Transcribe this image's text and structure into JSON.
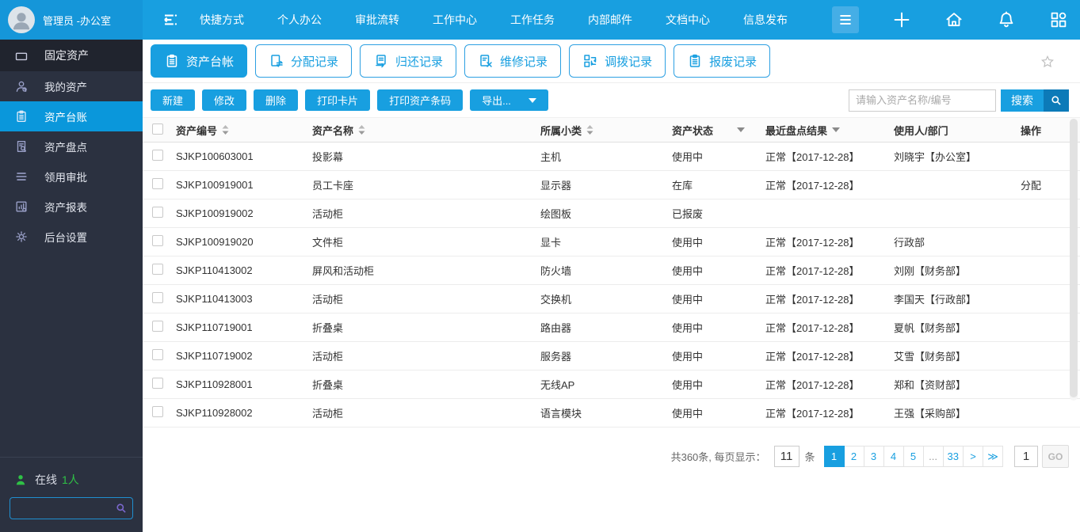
{
  "colors": {
    "accent": "#189fe0",
    "accent_dark": "#0c7ab8",
    "sidebar_bg": "#2b3140",
    "sidebar_active": "#0a97db",
    "online_green": "#2fc146"
  },
  "topbar": {
    "user": "管理员 -办公室",
    "nav": [
      "快捷方式",
      "个人办公",
      "审批流转",
      "工作中心",
      "工作任务",
      "内部邮件",
      "文档中心",
      "信息发布"
    ],
    "right_icons": [
      "plus",
      "home",
      "bell",
      "apps",
      "shirt",
      "power"
    ]
  },
  "sidebar": {
    "section": {
      "label": "固定资产",
      "icon": "briefcase"
    },
    "items": [
      {
        "label": "我的资产",
        "icon": "person",
        "active": false
      },
      {
        "label": "资产台账",
        "icon": "clipboard",
        "active": true
      },
      {
        "label": "资产盘点",
        "icon": "doc-search",
        "active": false
      },
      {
        "label": "领用审批",
        "icon": "layers",
        "active": false
      },
      {
        "label": "资产报表",
        "icon": "report",
        "active": false
      },
      {
        "label": "后台设置",
        "icon": "gear",
        "active": false
      }
    ],
    "online_label": "在线",
    "online_count": "1人"
  },
  "tabs": [
    {
      "label": "资产台帐",
      "icon": "clipboard",
      "active": true
    },
    {
      "label": "分配记录",
      "icon": "doc-swap",
      "active": false
    },
    {
      "label": "归还记录",
      "icon": "doc-return",
      "active": false
    },
    {
      "label": "维修记录",
      "icon": "doc-repair",
      "active": false
    },
    {
      "label": "调拨记录",
      "icon": "transfer",
      "active": false
    },
    {
      "label": "报废记录",
      "icon": "clipboard",
      "active": false
    }
  ],
  "toolbar": {
    "buttons": [
      "新建",
      "修改",
      "删除",
      "打印卡片",
      "打印资产条码"
    ],
    "export_label": "导出...",
    "search_placeholder": "请输入资产名称/编号",
    "search_label": "搜索"
  },
  "table": {
    "headers": [
      {
        "label": "资产编号",
        "sort": true
      },
      {
        "label": "资产名称",
        "sort": true
      },
      {
        "label": "所属小类",
        "sort": true
      },
      {
        "label": "资产状态",
        "filter": true
      },
      {
        "label": "最近盘点结果",
        "filter": true
      },
      {
        "label": "使用人/部门"
      },
      {
        "label": "操作"
      }
    ],
    "rows": [
      {
        "code": "SJKP100603001",
        "name": "投影幕",
        "category": "主机",
        "status": "使用中",
        "check": "正常【2017-12-28】",
        "user": "刘晓宇【办公室】",
        "action": ""
      },
      {
        "code": "SJKP100919001",
        "name": "员工卡座",
        "category": "显示器",
        "status": "在库",
        "check": "正常【2017-12-28】",
        "user": "",
        "action": "分配"
      },
      {
        "code": "SJKP100919002",
        "name": "活动柜",
        "category": "绘图板",
        "status": "已报废",
        "check": "",
        "user": "",
        "action": ""
      },
      {
        "code": "SJKP100919020",
        "name": "文件柜",
        "category": "显卡",
        "status": "使用中",
        "check": "正常【2017-12-28】",
        "user": "行政部",
        "action": ""
      },
      {
        "code": "SJKP110413002",
        "name": "屏风和活动柜",
        "category": "防火墙",
        "status": "使用中",
        "check": "正常【2017-12-28】",
        "user": "刘刚【财务部】",
        "action": ""
      },
      {
        "code": "SJKP110413003",
        "name": "活动柜",
        "category": "交换机",
        "status": "使用中",
        "check": "正常【2017-12-28】",
        "user": "李国天【行政部】",
        "action": ""
      },
      {
        "code": "SJKP110719001",
        "name": "折叠桌",
        "category": "路由器",
        "status": "使用中",
        "check": "正常【2017-12-28】",
        "user": "夏帆【财务部】",
        "action": ""
      },
      {
        "code": "SJKP110719002",
        "name": "活动柜",
        "category": "服务器",
        "status": "使用中",
        "check": "正常【2017-12-28】",
        "user": "艾雪【财务部】",
        "action": ""
      },
      {
        "code": "SJKP110928001",
        "name": "折叠桌",
        "category": "无线AP",
        "status": "使用中",
        "check": "正常【2017-12-28】",
        "user": "郑和【资财部】",
        "action": ""
      },
      {
        "code": "SJKP110928002",
        "name": "活动柜",
        "category": "语言模块",
        "status": "使用中",
        "check": "正常【2017-12-28】",
        "user": "王强【采购部】",
        "action": ""
      }
    ]
  },
  "pagination": {
    "total_label": "共360条, 每页显示：",
    "per_page": "11",
    "unit": "条",
    "pages": [
      "1",
      "2",
      "3",
      "4",
      "5",
      "...",
      "33",
      ">",
      "≫"
    ],
    "active_page": "1",
    "goto_value": "1",
    "go_label": "GO"
  }
}
